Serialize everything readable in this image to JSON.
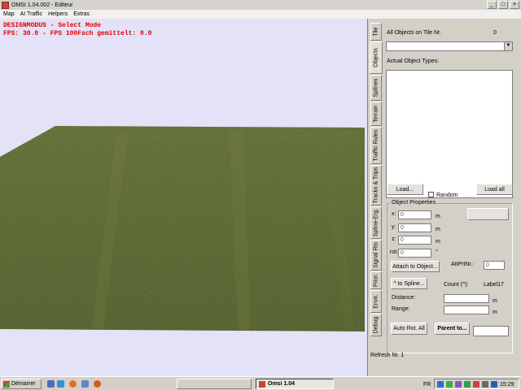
{
  "window": {
    "title": "OMSI 1.04.002 - Editeur",
    "controls": [
      "_",
      "□",
      "×"
    ]
  },
  "menu": [
    "Map",
    "AI Traffic",
    "Helpers",
    "Extras"
  ],
  "viewport": {
    "hud_line1": "DESIGNMODUS - Select Mode",
    "hud_line2": "FPS: 30.0 - FPS 100Fach gemittelt: 0.0",
    "sky_color": "#e3e2f8",
    "terrain_color": "#55622c",
    "hud_color": "#e00000"
  },
  "tabs": [
    "Tile",
    "Objects",
    "Splines",
    "Terrain",
    "Traffic Rules",
    "Tracks & Trips",
    "Spline-Erg.",
    "Signal Rts",
    "Prior.",
    "Envir.",
    "Debug"
  ],
  "active_tab": "Objects",
  "objects_panel": {
    "all_objects_label": "All Objects on Tile Nr.",
    "all_objects_count": "0",
    "actual_types_label": "Actual Object Types:",
    "load_button": "Load...",
    "random_label": "Random",
    "load_all_button": "Load all",
    "group_title": "Object Properties",
    "x_label": "x:",
    "x_value": "0",
    "x_unit": "m",
    "y_label": "y:",
    "y_value": "0",
    "y_unit": "m",
    "z_label": "z:",
    "z_value": "0",
    "z_unit": "m",
    "rot_label": "rot:",
    "rot_value": "0",
    "rot_unit": "°",
    "attach_button": "Attach to Object...",
    "att_prt_label": "AttPrtNr.:",
    "att_prt_value": "0",
    "to_spline_button": "^ to Spline...",
    "count_label": "Count (^):",
    "label17": "Label17",
    "distance_label": "Distance:",
    "distance_unit": "m",
    "range_label": "Range:",
    "range_unit": "m",
    "auto_rot_button": "Auto Rot. All",
    "parent_button": "Parent to...",
    "refresh_label": "Refresh Nr. 1"
  },
  "taskbar": {
    "start_label": "Démarrer",
    "task_label": "Omsi 1.04",
    "lang": "FR",
    "clock": "15:29"
  }
}
